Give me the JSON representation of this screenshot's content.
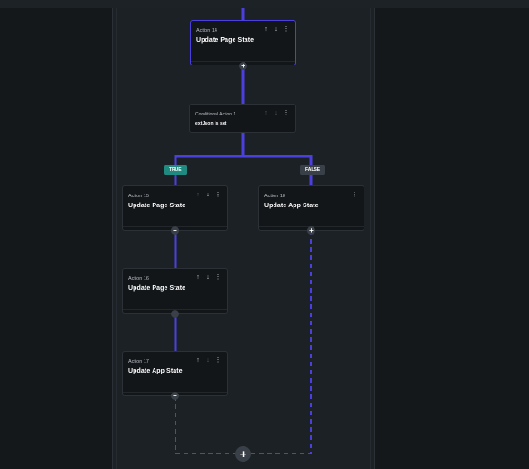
{
  "flow": {
    "action14": {
      "number": "Action 14",
      "title": "Update Page State"
    },
    "conditional": {
      "number": "Conditional Action 1",
      "condition": "extJson is set"
    },
    "branch_true": "TRUE",
    "branch_false": "FALSE",
    "action15": {
      "number": "Action 15",
      "title": "Update Page State"
    },
    "action16": {
      "number": "Action 16",
      "title": "Update Page State"
    },
    "action17": {
      "number": "Action 17",
      "title": "Update App State"
    },
    "action18": {
      "number": "Action 18",
      "title": "Update App State"
    }
  },
  "icons": {
    "move_up": "↑",
    "move_down": "↓",
    "more": "⋮",
    "add": "+"
  },
  "colors": {
    "wire_accent": "#4b3fe0",
    "true_badge": "#1f8a80",
    "false_badge": "#3a4047"
  }
}
